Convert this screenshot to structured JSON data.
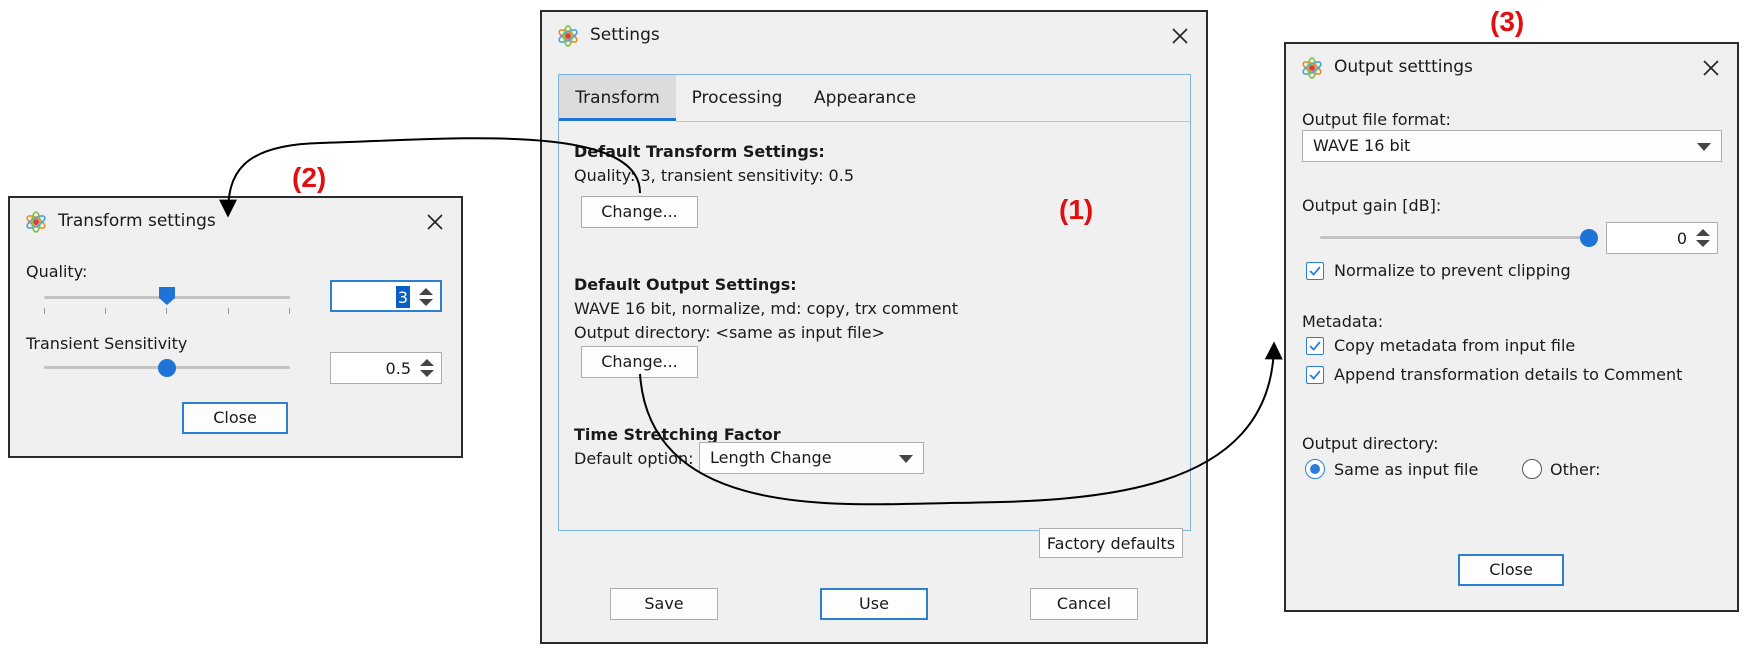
{
  "callouts": {
    "main": "(1)",
    "transform": "(2)",
    "output": "(3)"
  },
  "colors": {
    "accent": "#1f73d6",
    "callout": "#e01010"
  },
  "settings": {
    "title": "Settings",
    "tabs": [
      "Transform",
      "Processing",
      "Appearance"
    ],
    "active_tab": "Transform",
    "transform_heading": "Default Transform Settings:",
    "transform_summary": "Quality: 3, transient sensitivity: 0.5",
    "change_label": "Change...",
    "output_heading": "Default Output Settings:",
    "output_summary": "WAVE 16 bit, normalize, md: copy, trx comment",
    "output_dir_summary": "Output directory: <same as input file>",
    "stretch_heading": "Time Stretching Factor",
    "default_option_label": "Default option:",
    "default_option_value": "Length Change",
    "factory_defaults": "Factory defaults",
    "save": "Save",
    "use": "Use",
    "cancel": "Cancel"
  },
  "transform": {
    "title": "Transform settings",
    "quality_label": "Quality:",
    "quality_value": "3",
    "quality_level": 0.5,
    "sensitivity_label": "Transient Sensitivity",
    "sensitivity_value": "0.5",
    "sensitivity_level": 0.5,
    "close": "Close"
  },
  "output": {
    "title": "Output setttings",
    "format_label": "Output file format:",
    "format_value": "WAVE 16 bit",
    "gain_label": "Output gain [dB]:",
    "gain_value": "0",
    "gain_level": 1.0,
    "normalize_label": "Normalize to prevent clipping",
    "normalize_checked": true,
    "metadata_label": "Metadata:",
    "copy_metadata_label": "Copy metadata from input file",
    "copy_metadata_checked": true,
    "append_label": "Append transformation details to Comment",
    "append_checked": true,
    "directory_label": "Output directory:",
    "same_as_input": "Same as input file",
    "other": "Other:",
    "selected_directory": "Same as input file",
    "close": "Close"
  }
}
